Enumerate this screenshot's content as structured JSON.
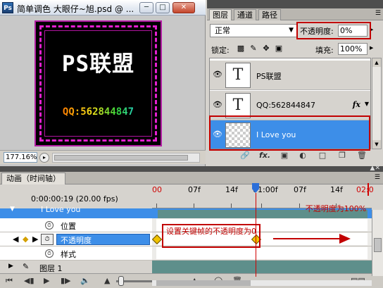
{
  "document": {
    "app_icon": "Ps",
    "title": "简单调色 大眼仔~旭.psd @ ...",
    "minimize": "─",
    "restore": "□",
    "close": "✕",
    "canvas_title": "PS联盟",
    "canvas_subtitle": "QQ:562844847",
    "zoom": "177.16%"
  },
  "layers_panel": {
    "tabs": [
      "图层",
      "通道",
      "路径"
    ],
    "blend_mode": "正常",
    "opacity_label": "不透明度:",
    "opacity_value": "0%",
    "lock_label": "锁定:",
    "fill_label": "填充:",
    "fill_value": "100%",
    "layers": [
      {
        "name": "PS联盟",
        "thumb": "T",
        "visible": true,
        "selected": false,
        "fx": ""
      },
      {
        "name": "QQ:562844847",
        "thumb": "T",
        "visible": true,
        "selected": false,
        "fx": "fx"
      },
      {
        "name": "I Love you",
        "thumb": "",
        "visible": true,
        "selected": true,
        "fx": ""
      }
    ],
    "bottom_icons": [
      "link-icon",
      "fx-icon",
      "mask-icon",
      "adjustment-icon",
      "folder-icon",
      "new-layer-icon",
      "trash-icon"
    ]
  },
  "timeline": {
    "tab": "动画（时间轴）",
    "timecode": "0:00:00:19",
    "fps": "(20.00 fps)",
    "ruler_labels": [
      {
        "text": "00",
        "red": true
      },
      {
        "text": "07f",
        "red": false
      },
      {
        "text": "14f",
        "red": false
      },
      {
        "text": "01:00f",
        "red": false
      },
      {
        "text": "07f",
        "red": false
      },
      {
        "text": "14f",
        "red": false
      },
      {
        "text": "02:0",
        "red": true
      }
    ],
    "rows": {
      "group": "I Love you",
      "position": "位置",
      "opacity": "不透明度",
      "style": "样式",
      "layer1": "图层 1"
    },
    "annotation_left": "设置关键帧的不透明度为0",
    "annotation_right": "不透明度为100%",
    "colors": {
      "accent": "#3d8ee8",
      "annotation": "#c20000",
      "keyframe": "#f0c300"
    }
  }
}
